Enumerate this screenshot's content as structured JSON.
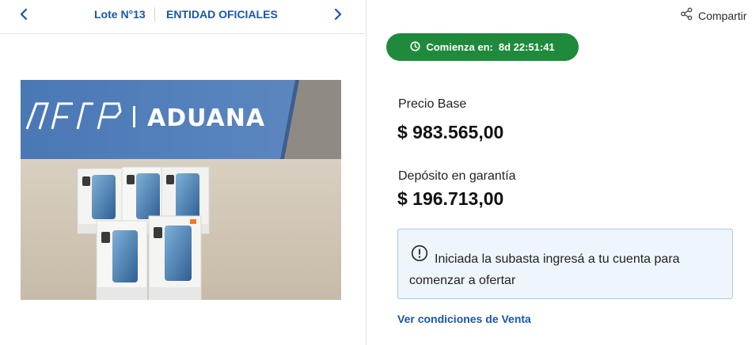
{
  "lot_nav": {
    "lot_label": "Lote N°13",
    "entity_label": "ENTIDAD OFICIALES",
    "prev_icon": "chevron-left-icon",
    "next_icon": "chevron-right-icon"
  },
  "photo": {
    "sign_text": "AFIP | ADUANA",
    "sign_brand": "AFIP",
    "sign_name": "ADUANA",
    "box_count": 5
  },
  "share": {
    "label": "Compartir",
    "icon": "share-icon"
  },
  "countdown": {
    "label": "Comienza en:",
    "value": "8d 22:51:41",
    "icon": "clock-icon",
    "color": "#1f8a3b"
  },
  "pricing": {
    "base_label": "Precio Base",
    "base_value": "$ 983.565,00",
    "deposit_label": "Depósito en garantía",
    "deposit_value": "$ 196.713,00"
  },
  "notice": {
    "icon": "info-circle-icon",
    "text": "Iniciada la subasta ingresá a tu cuenta para comenzar a ofertar"
  },
  "links": {
    "conditions": "Ver condiciones de Venta"
  },
  "colors": {
    "link_blue": "#1a56a8",
    "countdown_green": "#1f8a3b",
    "notice_bg": "#eef5fb",
    "notice_border": "#a9c7e6"
  }
}
